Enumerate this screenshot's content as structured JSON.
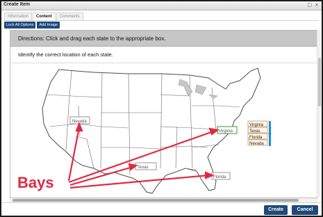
{
  "window": {
    "title": "Create Item",
    "controls": [
      "▢",
      "×"
    ]
  },
  "tabs": [
    {
      "label": "Information",
      "active": false
    },
    {
      "label": "Content",
      "active": true
    },
    {
      "label": "Comments",
      "active": false
    }
  ],
  "toolbar": {
    "lock_label": "Lock All Options",
    "add_image_label": "Add Image"
  },
  "question": {
    "directions": "Directions: Click and drag each state to the appropriate box.",
    "prompt": "Identify the correct location of each state."
  },
  "map": {
    "drop_boxes": [
      "Nevada",
      "Virginia",
      "Texas",
      "Florida"
    ],
    "answer_options": [
      "Virginia",
      "Texas",
      "Florida",
      "Nevada"
    ]
  },
  "annotation": {
    "label": "Bays",
    "color": "#e02a44"
  },
  "footer": {
    "create_label": "Create",
    "cancel_label": "Cancel"
  },
  "colors": {
    "accent": "#1f4a7a",
    "highlight": "#2e9c2e",
    "option_border": "#b07a3a",
    "option_handle": "#1a8fd8"
  }
}
